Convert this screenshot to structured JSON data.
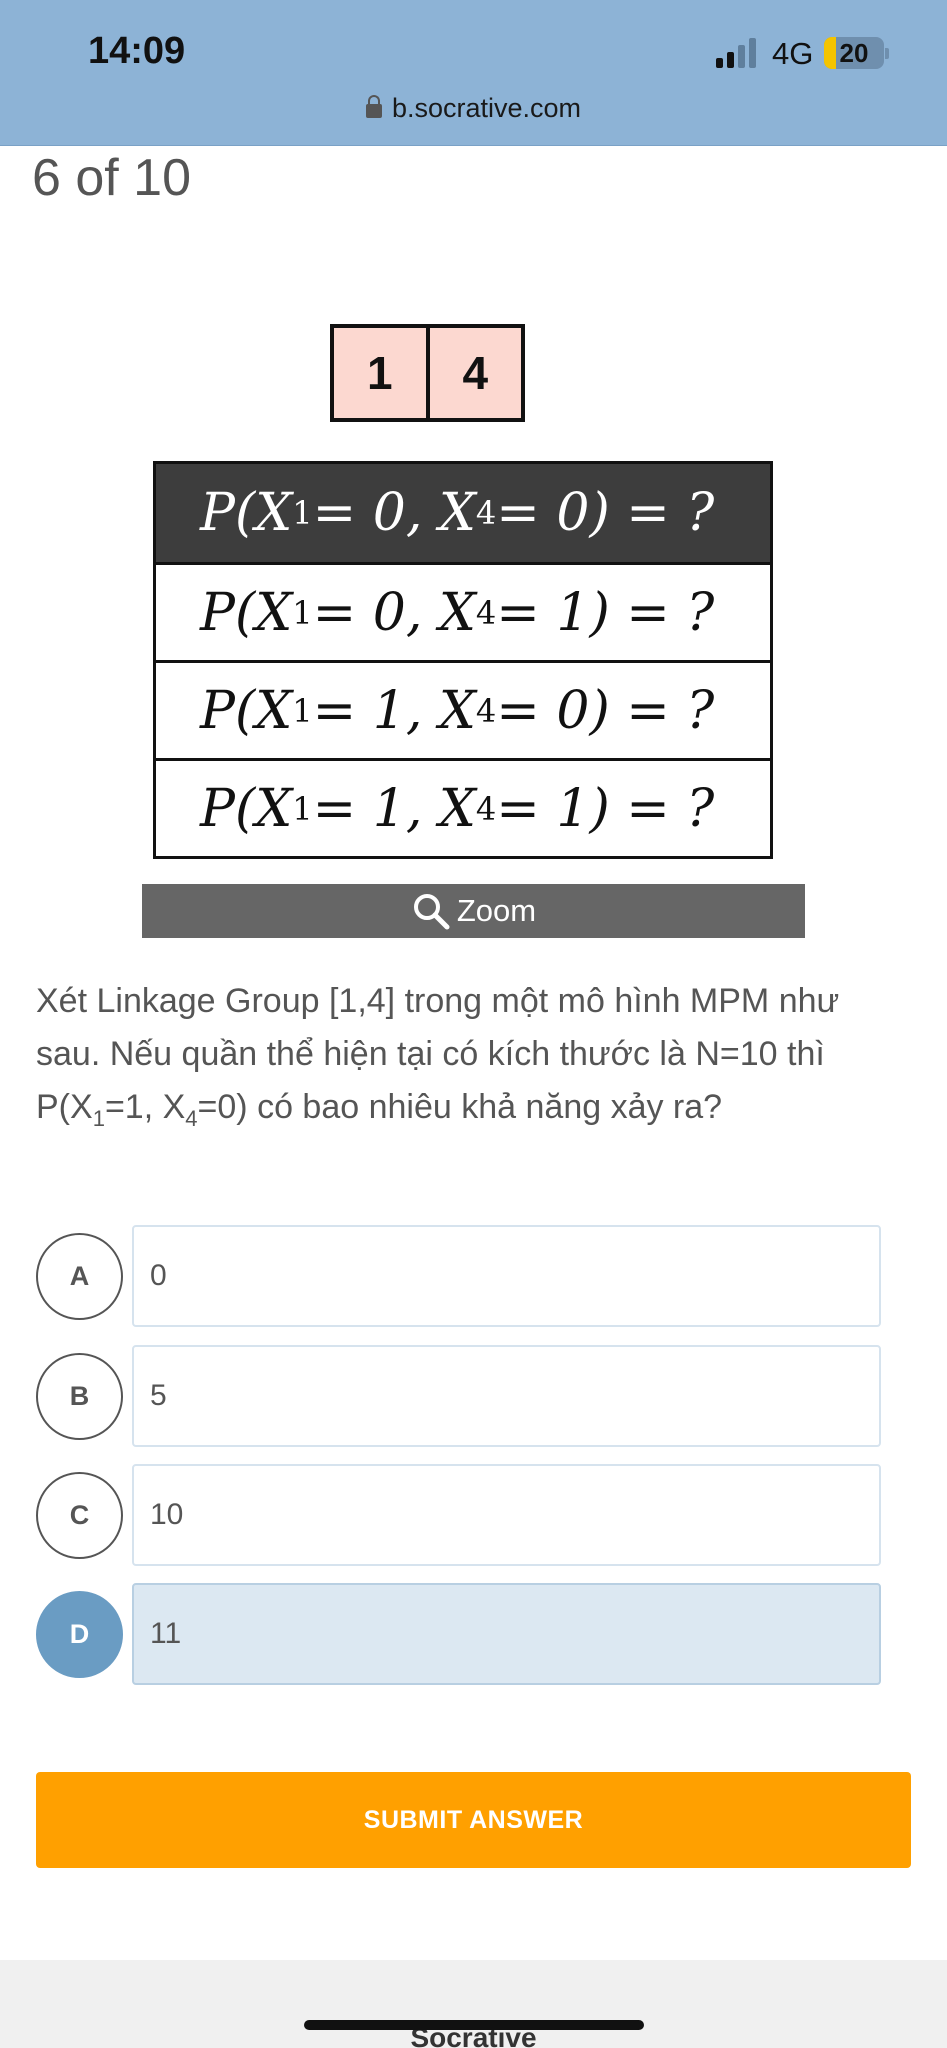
{
  "status_bar": {
    "time": "14:09",
    "network": "4G",
    "battery": "20",
    "battery_level": 0.2
  },
  "browser": {
    "url": "b.socrative.com"
  },
  "quiz": {
    "progress": "6 of 10",
    "figure": {
      "boxes": [
        "1",
        "4"
      ],
      "rows": [
        {
          "p": "P(X",
          "s1": "1",
          "m": " = 0, X",
          "s2": "4",
          "e": " = 0) = ?"
        },
        {
          "p": "P(X",
          "s1": "1",
          "m": " = 0, X",
          "s2": "4",
          "e": " = 1) = ?"
        },
        {
          "p": "P(X",
          "s1": "1",
          "m": " = 1, X",
          "s2": "4",
          "e": " = 0) = ?"
        },
        {
          "p": "P(X",
          "s1": "1",
          "m": " = 1, X",
          "s2": "4",
          "e": " = 1) = ?"
        }
      ]
    },
    "zoom_label": "Zoom",
    "question": {
      "part1": "Xét Linkage Group [1,4] trong một mô hình MPM như sau. Nếu quần thể hiện tại có kích thước là N=10 thì P(X",
      "sub1": "1",
      "part2": "=1, X",
      "sub2": "4",
      "part3": "=0) có bao nhiêu khả năng xảy ra?"
    },
    "options": [
      {
        "letter": "A",
        "text": "0"
      },
      {
        "letter": "B",
        "text": "5"
      },
      {
        "letter": "C",
        "text": "10"
      },
      {
        "letter": "D",
        "text": "11"
      }
    ],
    "selected_option": "D",
    "submit_label": "SUBMIT ANSWER"
  },
  "footer": {
    "brand": "Socrative"
  },
  "colors": {
    "status_bar": "#8db3d6",
    "selected": "#6a9cc3",
    "submit": "#ffa000"
  }
}
